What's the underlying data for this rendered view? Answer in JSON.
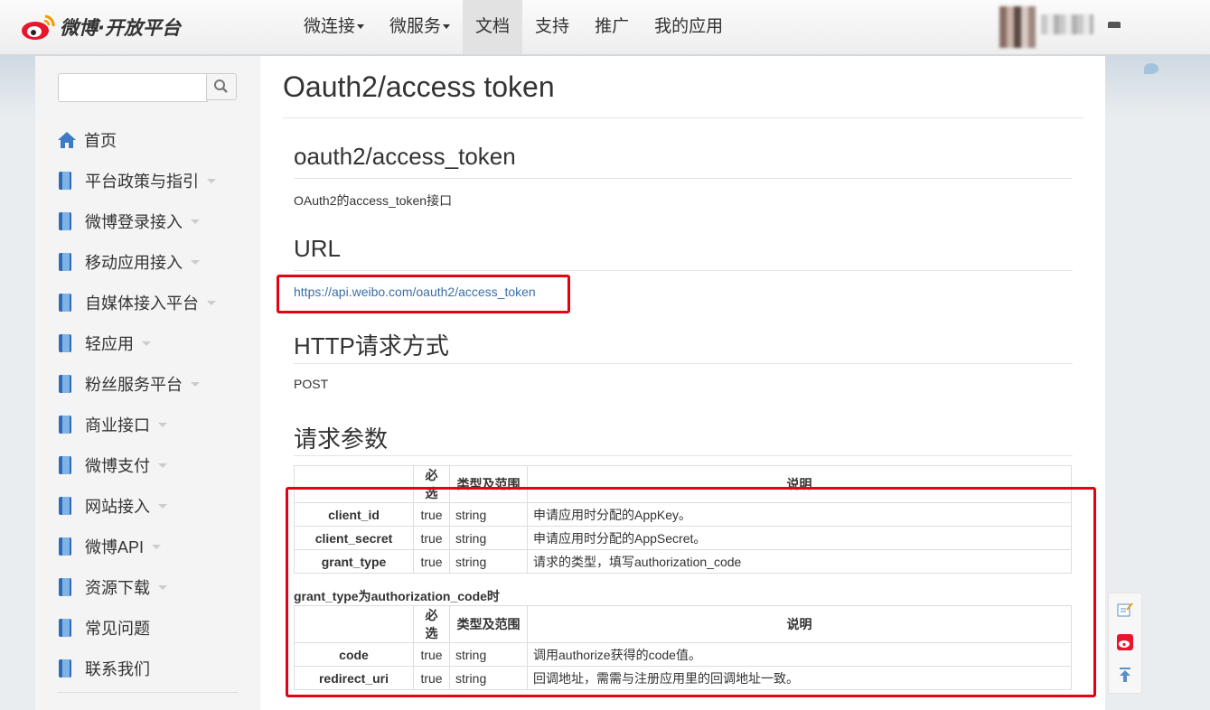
{
  "header": {
    "logo_text": "微博·开放平台",
    "nav": [
      {
        "label": "微连接",
        "dropdown": true
      },
      {
        "label": "微服务",
        "dropdown": true
      },
      {
        "label": "文档",
        "dropdown": false,
        "active": true
      },
      {
        "label": "支持",
        "dropdown": false
      },
      {
        "label": "推广",
        "dropdown": false
      },
      {
        "label": "我的应用",
        "dropdown": false
      }
    ]
  },
  "sidebar": {
    "search": {
      "value": "",
      "placeholder": ""
    },
    "items": [
      {
        "label": "首页",
        "icon": "home-icon",
        "dropdown": false
      },
      {
        "label": "平台政策与指引",
        "icon": "book-icon",
        "dropdown": true
      },
      {
        "label": "微博登录接入",
        "icon": "book-icon",
        "dropdown": true
      },
      {
        "label": "移动应用接入",
        "icon": "book-icon",
        "dropdown": true
      },
      {
        "label": "自媒体接入平台",
        "icon": "book-icon",
        "dropdown": true
      },
      {
        "label": "轻应用",
        "icon": "book-icon",
        "dropdown": true
      },
      {
        "label": "粉丝服务平台",
        "icon": "book-icon",
        "dropdown": true
      },
      {
        "label": "商业接口",
        "icon": "book-icon",
        "dropdown": true
      },
      {
        "label": "微博支付",
        "icon": "book-icon",
        "dropdown": true
      },
      {
        "label": "网站接入",
        "icon": "book-icon",
        "dropdown": true
      },
      {
        "label": "微博API",
        "icon": "book-icon",
        "dropdown": true
      },
      {
        "label": "资源下载",
        "icon": "book-icon",
        "dropdown": true
      },
      {
        "label": "常见问题",
        "icon": "book-icon",
        "dropdown": false
      },
      {
        "label": "联系我们",
        "icon": "book-icon",
        "dropdown": false
      }
    ]
  },
  "main": {
    "page_title": "Oauth2/access token",
    "api_name": "oauth2/access_token",
    "description": "OAuth2的access_token接口",
    "url_heading": "URL",
    "url": "https://api.weibo.com/oauth2/access_token",
    "method_heading": "HTTP请求方式",
    "method": "POST",
    "params_heading": "请求参数",
    "table_headers": [
      "",
      "必选",
      "类型及范围",
      "说明"
    ],
    "params": [
      {
        "name": "client_id",
        "required": "true",
        "type": "string",
        "desc": "申请应用时分配的AppKey。"
      },
      {
        "name": "client_secret",
        "required": "true",
        "type": "string",
        "desc": "申请应用时分配的AppSecret。"
      },
      {
        "name": "grant_type",
        "required": "true",
        "type": "string",
        "desc": "请求的类型，填写authorization_code"
      }
    ],
    "sub_heading": "grant_type为authorization_code时",
    "sub_params": [
      {
        "name": "code",
        "required": "true",
        "type": "string",
        "desc": "调用authorize获得的code值。"
      },
      {
        "name": "redirect_uri",
        "required": "true",
        "type": "string",
        "desc": "回调地址，需需与注册应用里的回调地址一致。"
      }
    ]
  },
  "colors": {
    "highlight": "#e60012",
    "link": "#3a6fa8",
    "accent": "#2f6bb5"
  }
}
